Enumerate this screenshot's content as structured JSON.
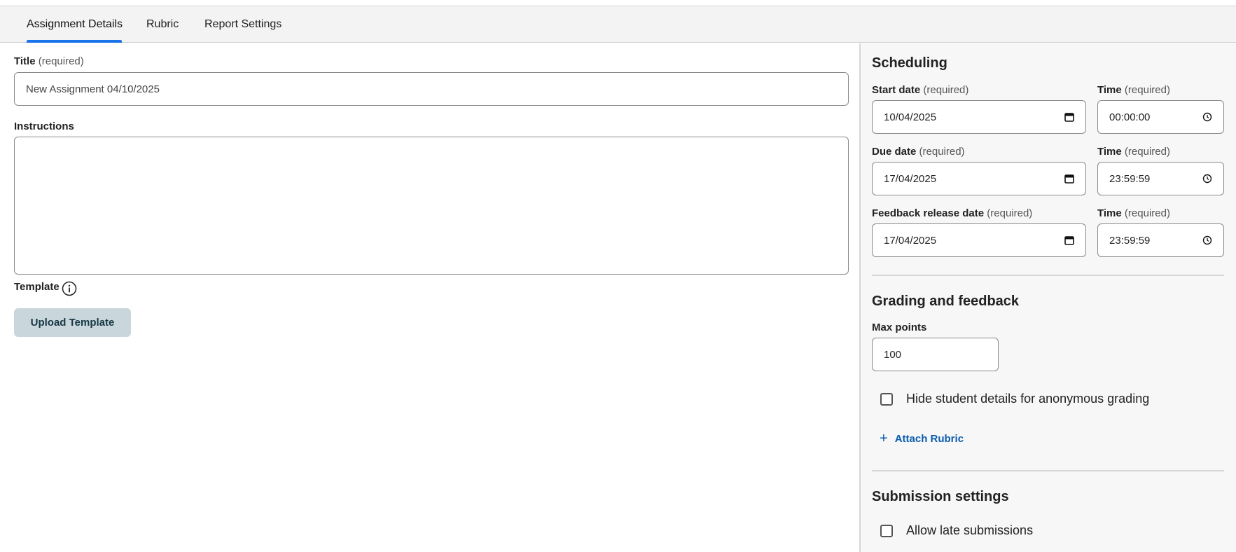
{
  "tabs": [
    {
      "label": "Assignment Details",
      "active": true
    },
    {
      "label": "Rubric",
      "active": false
    },
    {
      "label": "Report Settings",
      "active": false
    }
  ],
  "details": {
    "title_label": "Title",
    "title_req": "(required)",
    "title_value": "New Assignment 04/10/2025",
    "instructions_label": "Instructions",
    "template_label": "Template",
    "template_info_icon": "info-icon",
    "upload_button": "Upload Template"
  },
  "scheduling": {
    "heading": "Scheduling",
    "rows": [
      {
        "date_label": "Start date",
        "date_value": "10/04/2025",
        "time_value": "00:00:00"
      },
      {
        "date_label": "Due date",
        "date_value": "17/04/2025",
        "time_value": "23:59:59"
      },
      {
        "date_label": "Feedback release date",
        "date_value": "17/04/2025",
        "time_value": "23:59:59"
      }
    ],
    "time_label": "Time",
    "req": "(required)"
  },
  "grading": {
    "heading": "Grading and feedback",
    "max_points_label": "Max points",
    "max_points_value": "100",
    "anonymous_label": "Hide student details for anonymous grading",
    "anonymous_checked": false,
    "attach_rubric": "Attach Rubric"
  },
  "submission": {
    "heading": "Submission settings",
    "late_label": "Allow late submissions",
    "late_checked": false
  },
  "colors": {
    "accent": "#1a73e8",
    "link": "#0b5cad",
    "button_bg": "#c9d7dc"
  }
}
